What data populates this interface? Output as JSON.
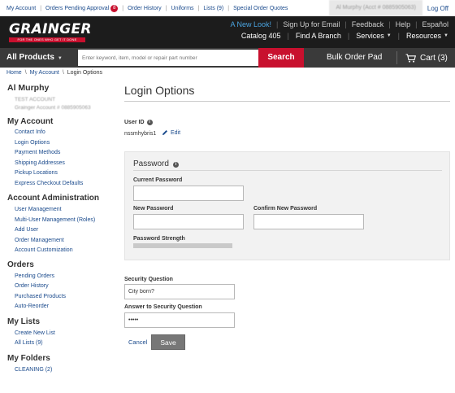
{
  "utility": {
    "links": [
      "My Account",
      "Orders Pending Approval",
      "Order History",
      "Uniforms",
      "Lists (9)",
      "Special Order Quotes"
    ],
    "pending_count": "8",
    "account_label": "Al Murphy (Acct # 0885905063)",
    "logoff": "Log Off"
  },
  "header": {
    "logo_text": "GRAINGER",
    "logo_tagline": "FOR THE ONES WHO GET IT DONE",
    "row1": [
      "A New Look!",
      "Sign Up for Email",
      "Feedback",
      "Help",
      "Español"
    ],
    "catalog": "Catalog 405",
    "find_branch": "Find A Branch",
    "services": "Services",
    "resources": "Resources"
  },
  "nav": {
    "all_products": "All Products",
    "search_placeholder": "Enter keyword, item, model or repair part number",
    "search_button": "Search",
    "bulk_order": "Bulk Order Pad",
    "cart": "Cart (3)"
  },
  "breadcrumb": [
    "Home",
    "My Account",
    "Login Options"
  ],
  "sidebar": {
    "user_name": "Al Murphy",
    "account_lines": [
      "TEST ACCOUNT",
      "Grainger Account # 0885905063"
    ],
    "my_account": {
      "title": "My Account",
      "items": [
        "Contact Info",
        "Login Options",
        "Payment Methods",
        "Shipping Addresses",
        "Pickup Locations",
        "Express Checkout Defaults"
      ]
    },
    "account_admin": {
      "title": "Account Administration",
      "items": [
        "User Management",
        "Multi-User Management (Roles)",
        "Add User",
        "Order Management",
        "Account Customization"
      ]
    },
    "orders": {
      "title": "Orders",
      "items": [
        "Pending Orders",
        "Order History",
        "Purchased Products",
        "Auto-Reorder"
      ]
    },
    "my_lists": {
      "title": "My Lists",
      "items": [
        "Create New List",
        "All Lists (9)"
      ]
    },
    "my_folders": {
      "title": "My Folders",
      "items": [
        "CLEANING (2)"
      ]
    }
  },
  "main": {
    "title": "Login Options",
    "user_id_label": "User ID",
    "user_id_value": "nssmhybris1",
    "edit_label": "Edit",
    "password": {
      "title": "Password",
      "current_label": "Current Password",
      "new_label": "New Password",
      "confirm_label": "Confirm New Password",
      "strength_label": "Password Strength",
      "strength_level": 0
    },
    "security_question_label": "Security Question",
    "security_question_value": "City born?",
    "answer_label": "Answer to Security Question",
    "answer_value": "•••••",
    "cancel": "Cancel",
    "save": "Save"
  },
  "colors": {
    "brand_red": "#c8102e",
    "header_bg": "#1c1c1c",
    "nav_bg": "#3a3a3a",
    "link_blue": "#1a4a8c",
    "new_look": "#4aa3df"
  }
}
